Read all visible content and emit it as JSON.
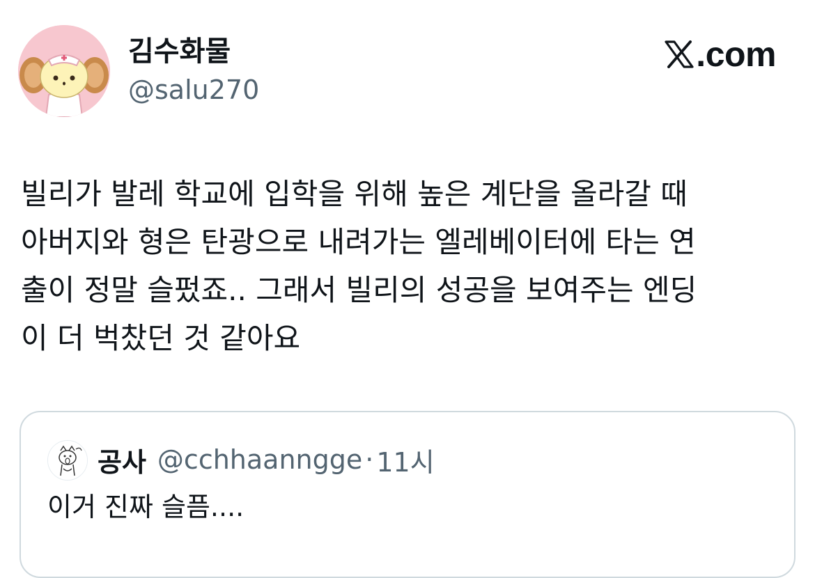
{
  "author": {
    "display_name": "김수화물",
    "handle": "@salu270",
    "avatar_icon": "nurse-bunny-avatar-icon"
  },
  "brand": {
    "label": ".com",
    "icon": "x-logo-icon"
  },
  "tweet": {
    "lines": [
      "빌리가 발레 학교에 입학을 위해 높은 계단을 올라갈 때",
      "아버지와 형은 탄광으로 내려가는 엘레베이터에 타는 연",
      "출이 정말 슬펐죠.. 그래서 빌리의 성공을 보여주는 엔딩",
      "이 더 벅찼던 것 같아요"
    ]
  },
  "quoted_tweet": {
    "display_name": "공사",
    "handle": "@cchhaanngge",
    "separator": "·",
    "time": "11시",
    "text": "이거 진짜 슬픔....",
    "avatar_icon": "doodle-creature-avatar-icon"
  },
  "colors": {
    "text_primary": "#0f1419",
    "text_secondary": "#536471",
    "border": "#cfd9de",
    "avatar_bg": "#f7c7cf"
  }
}
